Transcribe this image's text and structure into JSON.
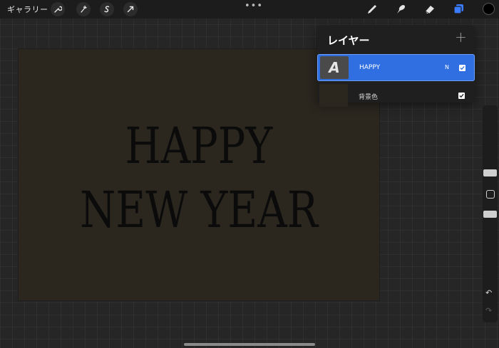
{
  "topbar": {
    "gallery_label": "ギャラリー",
    "more_label": "•••",
    "left_tools": [
      "wrench-icon",
      "magic-wand-icon",
      "selection-icon",
      "transform-icon"
    ],
    "right_tools": [
      "brush-icon",
      "smudge-icon",
      "eraser-icon",
      "layers-icon"
    ],
    "current_color": "#000000",
    "active_tool_color": "#3b7cff"
  },
  "canvas": {
    "line1": "HAPPY",
    "line2": "NEW YEAR",
    "background_color": "#2b271f"
  },
  "layers_panel": {
    "title": "レイヤー",
    "add_label": "+",
    "layers": [
      {
        "name": "HAPPY",
        "thumb_glyph": "A",
        "blend_mode": "N",
        "visible": true,
        "selected": true
      },
      {
        "name": "背景色",
        "visible": true,
        "selected": false
      }
    ]
  },
  "sidebar": {
    "undo_label": "↶",
    "redo_label": "↷"
  }
}
